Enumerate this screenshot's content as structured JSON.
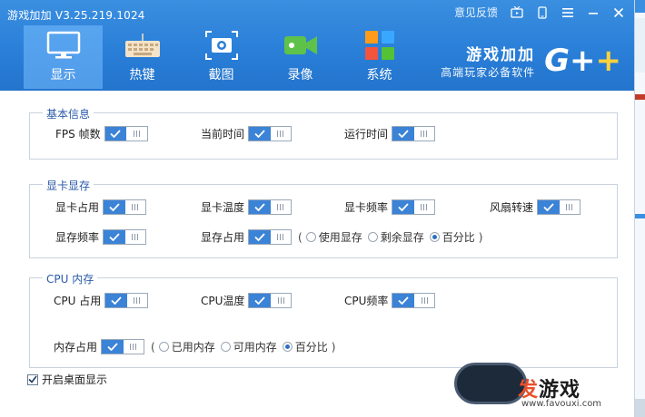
{
  "window": {
    "title": "游戏加加 V3.25.219.1024"
  },
  "titlebar": {
    "feedback": "意见反馈",
    "icons": [
      "tv-icon",
      "phone-icon",
      "menu-icon",
      "minimize-icon",
      "close-icon"
    ]
  },
  "nav": {
    "tabs": [
      {
        "id": "display",
        "label": "显示",
        "icon": "monitor-icon",
        "active": true
      },
      {
        "id": "hotkey",
        "label": "热键",
        "icon": "keyboard-icon",
        "active": false
      },
      {
        "id": "screenshot",
        "label": "截图",
        "icon": "camera-icon",
        "active": false
      },
      {
        "id": "record",
        "label": "录像",
        "icon": "video-camera-icon",
        "active": false
      },
      {
        "id": "system",
        "label": "系统",
        "icon": "grid-icon",
        "active": false
      }
    ]
  },
  "brand": {
    "name": "游戏加加",
    "slogan": "高端玩家必备软件",
    "logo": "G+",
    "logo_plus": "+"
  },
  "groups": {
    "basic": {
      "title": "基本信息",
      "items": [
        {
          "label": "FPS 帧数",
          "on": true
        },
        {
          "label": "当前时间",
          "on": true
        },
        {
          "label": "运行时间",
          "on": true
        }
      ]
    },
    "gpu": {
      "title": "显卡显存",
      "row1": [
        {
          "label": "显卡占用",
          "on": true
        },
        {
          "label": "显卡温度",
          "on": true
        },
        {
          "label": "显卡频率",
          "on": true
        },
        {
          "label": "风扇转速",
          "on": true
        }
      ],
      "row2": [
        {
          "label": "显存频率",
          "on": true
        },
        {
          "label": "显存占用",
          "on": true
        }
      ],
      "vram_mode": {
        "options": [
          "使用显存",
          "剩余显存",
          "百分比"
        ],
        "selected": "百分比"
      }
    },
    "cpu": {
      "title": "CPU 内存",
      "row1": [
        {
          "label": "CPU 占用",
          "on": true
        },
        {
          "label": "CPU温度",
          "on": true
        },
        {
          "label": "CPU频率",
          "on": true
        }
      ],
      "memory": {
        "label": "内存占用",
        "on": true
      },
      "mem_mode": {
        "options": [
          "已用内存",
          "可用内存",
          "百分比"
        ],
        "selected": "百分比"
      }
    }
  },
  "desktop_display": {
    "label": "开启桌面显示",
    "checked": true
  },
  "watermark": {
    "text_a": "发",
    "text_b": "游戏",
    "url": "www.favouxi.com"
  },
  "paren_open": "(",
  "paren_close": ")",
  "colors": {
    "titlebar": "#2a7fd8",
    "toggle_on": "#3b83d6",
    "group_title": "#2a5aa8",
    "accent_yellow": "#ffd23a"
  }
}
